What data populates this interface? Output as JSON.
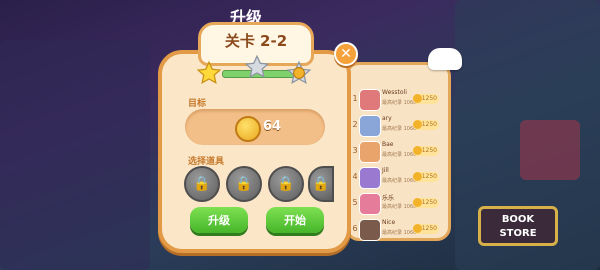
{
  "background": {
    "title": "升级"
  },
  "level_panel": {
    "level_title": "关卡 2-2",
    "goal_label": "目标",
    "goal_value": "64",
    "tools_label": "选择道具",
    "upgrade_button": "升级",
    "start_button": "开始",
    "stars_earned": 1,
    "stars_total": 3
  },
  "ranking": {
    "rows": [
      {
        "rank": "1",
        "name": "Wesstoli",
        "sub": "最高纪录 1060-2",
        "score": "1250"
      },
      {
        "rank": "2",
        "name": "ary",
        "sub": "最高纪录 1060-2",
        "score": "1250"
      },
      {
        "rank": "3",
        "name": "Bae",
        "sub": "最高纪录 1060-2",
        "score": "1250"
      },
      {
        "rank": "4",
        "name": "Jill",
        "sub": "最高纪录 1060-2",
        "score": "1250"
      },
      {
        "rank": "5",
        "name": "乐乐",
        "sub": "最高纪录 1060-2",
        "score": "1250"
      },
      {
        "rank": "6",
        "name": "Nice",
        "sub": "最高纪录 1060-2",
        "score": "1250"
      }
    ]
  },
  "storefront": {
    "line1": "BOOK",
    "line2": "STORE"
  },
  "colors": {
    "panel_border": "#e29a46",
    "button_green": "#46b52a",
    "accent_gold": "#f2b22a"
  }
}
